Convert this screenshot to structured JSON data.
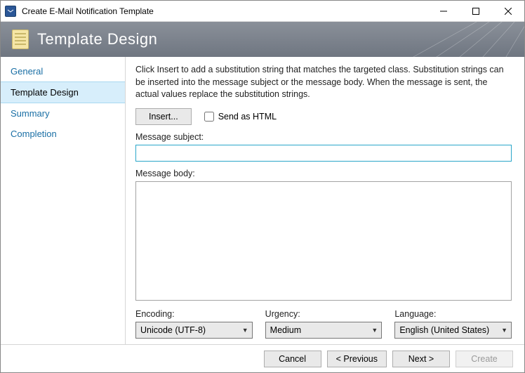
{
  "window": {
    "title": "Create E-Mail Notification Template"
  },
  "banner": {
    "heading": "Template Design"
  },
  "sidebar": {
    "items": [
      {
        "label": "General"
      },
      {
        "label": "Template Design"
      },
      {
        "label": "Summary"
      },
      {
        "label": "Completion"
      }
    ],
    "selected_index": 1
  },
  "main": {
    "intro": "Click Insert to add a substitution string that matches the targeted class. Substitution strings can be inserted into the message subject or the message body. When the message is sent, the actual values replace the substitution strings.",
    "insert_label": "Insert...",
    "send_html_label": "Send as HTML",
    "send_html_checked": false,
    "subject_label": "Message subject:",
    "subject_value": "",
    "body_label": "Message body:",
    "body_value": "",
    "encoding": {
      "label": "Encoding:",
      "value": "Unicode (UTF-8)"
    },
    "urgency": {
      "label": "Urgency:",
      "value": "Medium"
    },
    "language": {
      "label": "Language:",
      "value": "English (United States)"
    }
  },
  "footer": {
    "cancel": "Cancel",
    "previous": "< Previous",
    "next": "Next >",
    "create": "Create"
  }
}
